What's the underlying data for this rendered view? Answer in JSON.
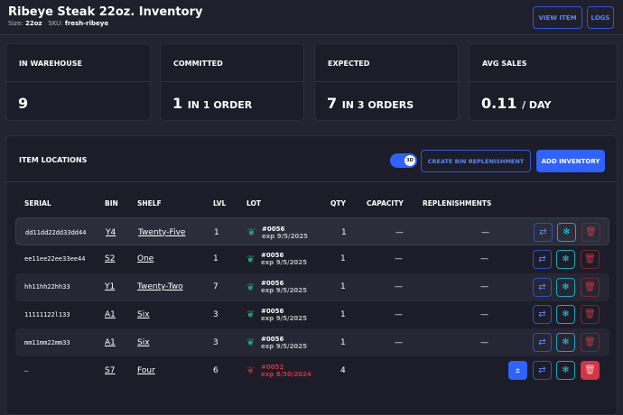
{
  "header": {
    "title": "Ribeye Steak 22oz. Inventory",
    "size_label": "Size:",
    "size": "22oz",
    "sku_label": "SKU:",
    "sku": "fresh-ribeye",
    "view_item": "VIEW ITEM",
    "logs": "LOGS"
  },
  "cards": [
    {
      "label": "IN WAREHOUSE",
      "value": "9",
      "suffix": ""
    },
    {
      "label": "COMMITTED",
      "value": "1",
      "suffix": "IN 1 ORDER"
    },
    {
      "label": "EXPECTED",
      "value": "7",
      "suffix": "IN 3 ORDERS"
    },
    {
      "label": "AVG SALES",
      "value": "0.11",
      "suffix": "/ DAY"
    }
  ],
  "locations": {
    "title": "ITEM LOCATIONS",
    "toggle_label": "3D",
    "toggle_on": true,
    "create_bin": "CREATE BIN REPLENISHMENT",
    "add_inventory": "ADD INVENTORY",
    "columns": [
      "SERIAL",
      "BIN",
      "SHELF",
      "LVL",
      "LOT",
      "QTY",
      "CAPACITY",
      "REPLENISHMENTS"
    ],
    "rows": [
      {
        "serial": "dd11dd22dd33dd44",
        "bin": "Y4",
        "shelf": "Twenty-Five",
        "lvl": "1",
        "lot": "#0056",
        "exp": "exp 9/5/2025",
        "qty": "1",
        "capacity": "—",
        "repl": "—"
      },
      {
        "serial": "ee11ee22ee33ee44",
        "bin": "S2",
        "shelf": "One",
        "lvl": "1",
        "lot": "#0056",
        "exp": "exp 9/5/2025",
        "qty": "1",
        "capacity": "—",
        "repl": "—"
      },
      {
        "serial": "hh11hh22hh33",
        "bin": "Y1",
        "shelf": "Twenty-Two",
        "lvl": "7",
        "lot": "#0056",
        "exp": "exp 9/5/2025",
        "qty": "1",
        "capacity": "—",
        "repl": "—"
      },
      {
        "serial": "11111122l133",
        "bin": "A1",
        "shelf": "Six",
        "lvl": "3",
        "lot": "#0056",
        "exp": "exp 9/5/2025",
        "qty": "1",
        "capacity": "—",
        "repl": "—"
      },
      {
        "serial": "mm11mm22mm33",
        "bin": "A1",
        "shelf": "Six",
        "lvl": "3",
        "lot": "#0056",
        "exp": "exp 9/5/2025",
        "qty": "1",
        "capacity": "—",
        "repl": "—"
      },
      {
        "serial": "—",
        "bin": "S7",
        "shelf": "Four",
        "lvl": "6",
        "lot": "#0052",
        "exp": "exp 8/30/2024",
        "qty": "4",
        "capacity": "",
        "repl": ""
      }
    ]
  },
  "icons": {
    "lot": "leaf-icon",
    "move": "arrows-swap-icon",
    "freeze": "snowflake-icon",
    "delete": "trash-icon",
    "adjust": "plus-minus-icon"
  },
  "colors": {
    "accent": "#2f62ff",
    "freeze": "#22d3ee",
    "danger": "#d33446",
    "lot_ok": "#1fa37a"
  }
}
